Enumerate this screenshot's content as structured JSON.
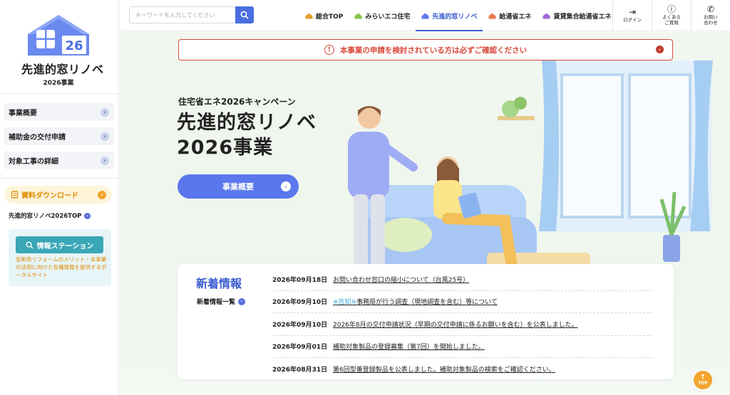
{
  "sidebar": {
    "logo_title": "先進的窓リノベ",
    "logo_sub": "2026事業",
    "logo_number": "26",
    "items": [
      {
        "label": "事業概要"
      },
      {
        "label": "補助金の交付申請"
      },
      {
        "label": "対象工事の詳細"
      }
    ],
    "download_label": "資料ダウンロード",
    "top_link": "先進的窓リノベ2026TOP",
    "station_label": "情報ステーション",
    "station_desc": "窓断熱リフォームのメリット・本事業の活用に向けた各種情報を提供するポータルサイト"
  },
  "header": {
    "search_placeholder": "キーワードを入力してください",
    "nav": [
      {
        "label": "総合TOP",
        "color": "#e0a030"
      },
      {
        "label": "みらいエコ住宅",
        "color": "#8cc04a"
      },
      {
        "label": "先進的窓リノベ",
        "color": "#5a78ec",
        "active": true
      },
      {
        "label": "給湯省エネ",
        "color": "#e87a50"
      },
      {
        "label": "賃貸集合給湯省エネ",
        "color": "#9a6ad0"
      }
    ],
    "buttons": [
      {
        "icon": "login-icon",
        "label": "ログイン"
      },
      {
        "icon": "help-icon",
        "label": "よくある\nご質問"
      },
      {
        "icon": "phone-icon",
        "label": "お問い\n合わせ"
      }
    ]
  },
  "notice": {
    "text": "本事業の申請を検討されている方は必ずご確認ください"
  },
  "hero": {
    "sub": "住宅省エネ2026キャンペーン",
    "title_line1": "先進的窓リノベ",
    "title_line2": "2026事業",
    "button": "事業概要"
  },
  "news": {
    "title": "新着情報",
    "all_link": "新着情報一覧",
    "items": [
      {
        "date": "2026年09月18日",
        "tag": "",
        "text": "お問い合わせ窓口の縮小について（台風25号）"
      },
      {
        "date": "2026年09月10日",
        "tag": "※告知※",
        "text": "事務局が行う調査（現地調査を含む）等について"
      },
      {
        "date": "2026年09月10日",
        "tag": "",
        "text": "2026年8月の交付申請状況（早期の交付申請に係るお願いを含む）を公表しました。"
      },
      {
        "date": "2026年09月01日",
        "tag": "",
        "text": "補助対象製品の登録募集（第7回）を開始しました。"
      },
      {
        "date": "2026年08月31日",
        "tag": "",
        "text": "第6回型番登録製品を公表しました。補助対象製品の検索をご確認ください。"
      }
    ]
  },
  "top_button": "TOP",
  "colors": {
    "accent": "#5a78ec",
    "notice": "#d94a3a",
    "orange": "#f3a52e",
    "teal": "#3aa7b7"
  }
}
